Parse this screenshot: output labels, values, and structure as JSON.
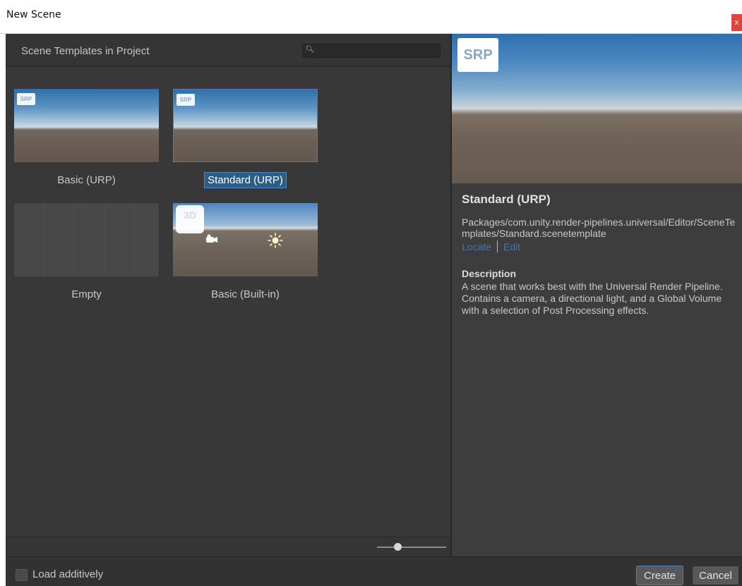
{
  "window": {
    "title": "New Scene",
    "close_glyph": "x"
  },
  "left_panel": {
    "header_title": "Scene Templates in Project",
    "search_placeholder": "",
    "search_icon": "search-icon"
  },
  "templates": [
    {
      "label": "Basic (URP)",
      "badge": "SRP",
      "selected": false
    },
    {
      "label": "Standard (URP)",
      "badge": "SRP",
      "selected": true
    },
    {
      "label": "Empty",
      "badge": "",
      "selected": false
    },
    {
      "label": "Basic (Built-in)",
      "badge": "3D",
      "selected": false
    }
  ],
  "zoom_slider": {
    "value": 0.3
  },
  "details": {
    "preview_badge": "SRP",
    "name": "Standard (URP)",
    "path": "Packages/com.unity.render-pipelines.universal/Editor/SceneTemplates/Standard.scenetemplate",
    "locate_label": "Locate",
    "edit_label": "Edit",
    "description_title": "Description",
    "description": "A scene that works best with the Universal Render Pipeline. Contains a camera, a directional light, and a Global Volume with a selection of Post Processing effects."
  },
  "footer": {
    "load_additively_label": "Load additively",
    "load_additively_checked": false,
    "create_label": "Create",
    "cancel_label": "Cancel"
  },
  "colors": {
    "accent": "#4d7fbf",
    "selection": "#2c5d87",
    "link": "#4a74a8",
    "close": "#e0433d"
  }
}
